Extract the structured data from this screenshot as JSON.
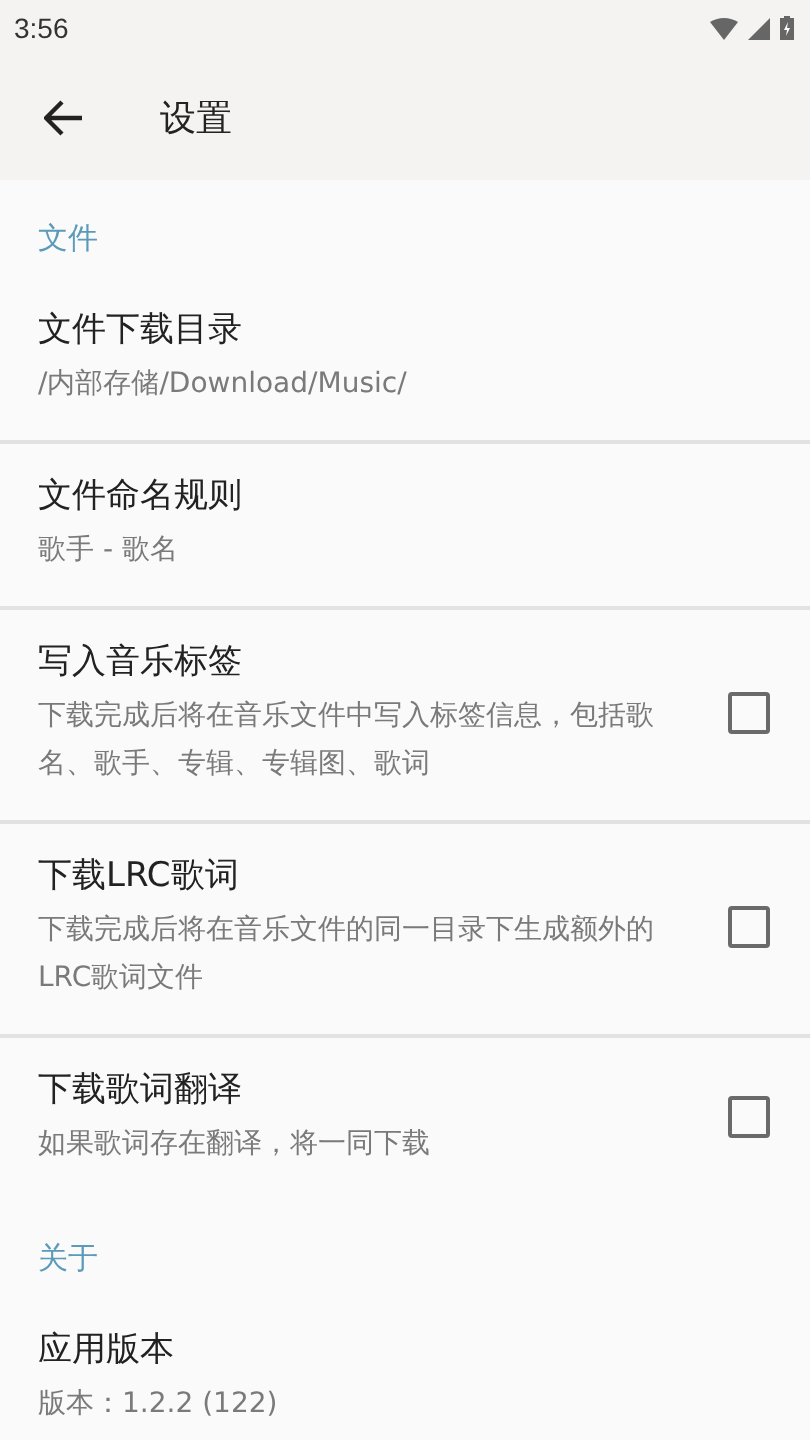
{
  "status_bar": {
    "time": "3:56"
  },
  "toolbar": {
    "title": "设置"
  },
  "sections": [
    {
      "header": "文件",
      "items": [
        {
          "kind": "text",
          "title": "文件下载目录",
          "summary": "/内部存储/Download/Music/"
        },
        {
          "kind": "text",
          "title": "文件命名规则",
          "summary": "歌手 - 歌名"
        },
        {
          "kind": "checkbox",
          "title": "写入音乐标签",
          "summary": "下载完成后将在音乐文件中写入标签信息，包括歌名、歌手、专辑、专辑图、歌词",
          "checked": false
        },
        {
          "kind": "checkbox",
          "title": "下载LRC歌词",
          "summary": "下载完成后将在音乐文件的同一目录下生成额外的LRC歌词文件",
          "checked": false
        },
        {
          "kind": "checkbox",
          "title": "下载歌词翻译",
          "summary": "如果歌词存在翻译，将一同下载",
          "checked": false
        }
      ]
    },
    {
      "header": "关于",
      "items": [
        {
          "kind": "text",
          "title": "应用版本",
          "summary": "版本：1.2.2 (122)"
        }
      ]
    }
  ]
}
